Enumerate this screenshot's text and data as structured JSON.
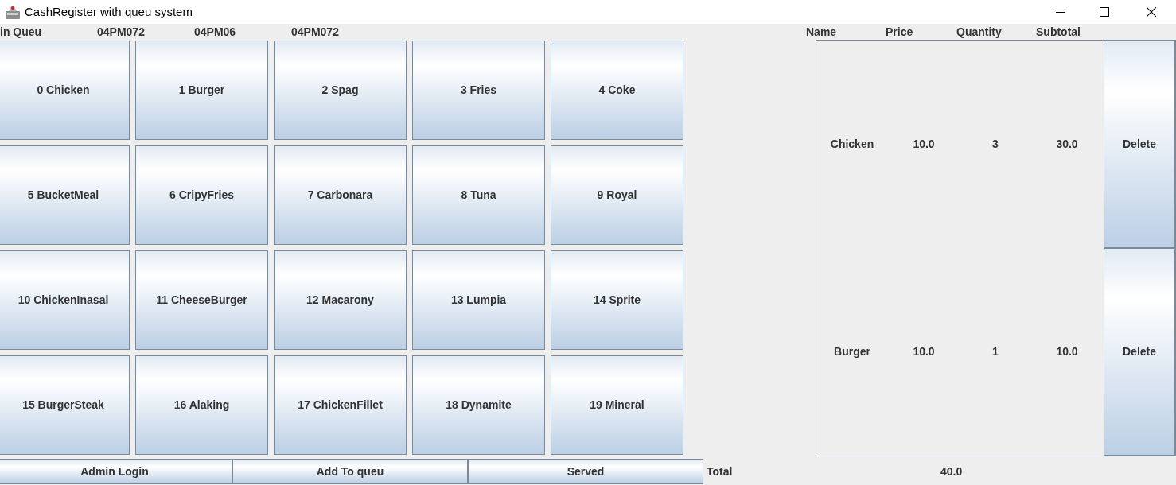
{
  "window": {
    "title": "CashRegister with queu system"
  },
  "queue": {
    "label": "in Queu",
    "orders": [
      "04PM072",
      "04PM06",
      "04PM072"
    ]
  },
  "menu_items": [
    "0 Chicken",
    "1 Burger",
    "2 Spag",
    "3 Fries",
    "4 Coke",
    "5 BucketMeal",
    "6 CripyFries",
    "7 Carbonara",
    "8 Tuna",
    "9 Royal",
    "10 ChickenInasal",
    "11 CheeseBurger",
    "12 Macarony",
    "13 Lumpia",
    "14 Sprite",
    "15 BurgerSteak",
    "16 Alaking",
    "17 ChickenFillet",
    "18 Dynamite",
    "19 Mineral"
  ],
  "order_table": {
    "columns": [
      "Name",
      "Price",
      "Quantity",
      "Subtotal"
    ],
    "rows": [
      {
        "name": "Chicken",
        "price": "10.0",
        "quantity": "3",
        "subtotal": "30.0",
        "action": "Delete"
      },
      {
        "name": "Burger",
        "price": "10.0",
        "quantity": "1",
        "subtotal": "10.0",
        "action": "Delete"
      }
    ]
  },
  "actions": [
    "Admin Login",
    "Add To queu",
    "Served"
  ],
  "total": {
    "label": "Total",
    "value": "40.0"
  }
}
